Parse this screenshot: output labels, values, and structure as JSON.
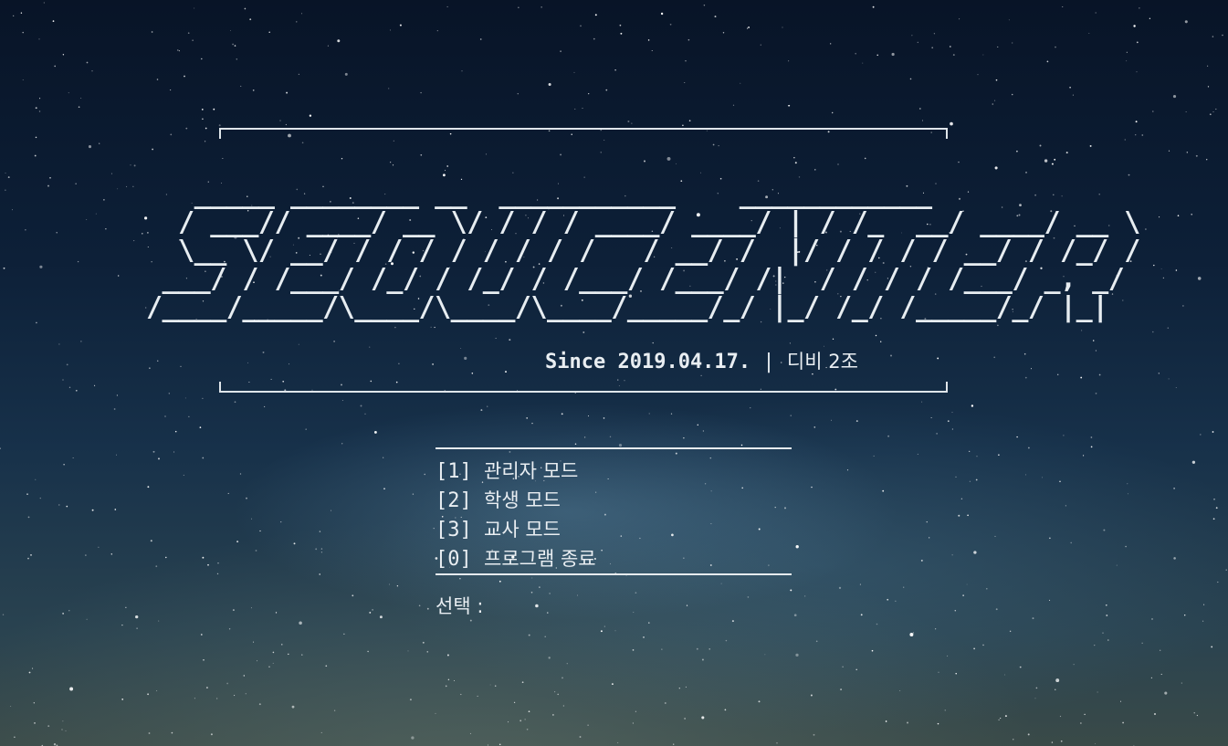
{
  "banner": {
    "ascii_logo": "   _____ ________ __  ___________    ____________\n  / ___// ____/ __ \\/ / / / ____/ ____/ | / /_  __/ ____/ __ \\\n  \\__ \\/ __/ / / / / / / / /   / __/ /  |/ / / / / __/ / /_/ /\n ___/ / /___/ /_/ / /_/ / /___/ /___/ /|  / / / / /___/ _, _/\n/____/_____/\\____/\\____/\\____/_____/_/ |_/ /_/ /_____/_/ |_|",
    "since": "Since 2019.04.17.",
    "separator": "|",
    "team": "디비 2조"
  },
  "menu": {
    "items": [
      {
        "key": "[1]",
        "label": "관리자 모드"
      },
      {
        "key": "[2]",
        "label": "학생 모드"
      },
      {
        "key": "[3]",
        "label": "교사 모드"
      },
      {
        "key": "[0]",
        "label": "프로그램 종료"
      }
    ],
    "prompt_label": "선택 :",
    "prompt_value": ""
  },
  "colors": {
    "text": "#e9eef2",
    "sky_top": "#081427",
    "sky_bottom": "#3a4a48"
  }
}
